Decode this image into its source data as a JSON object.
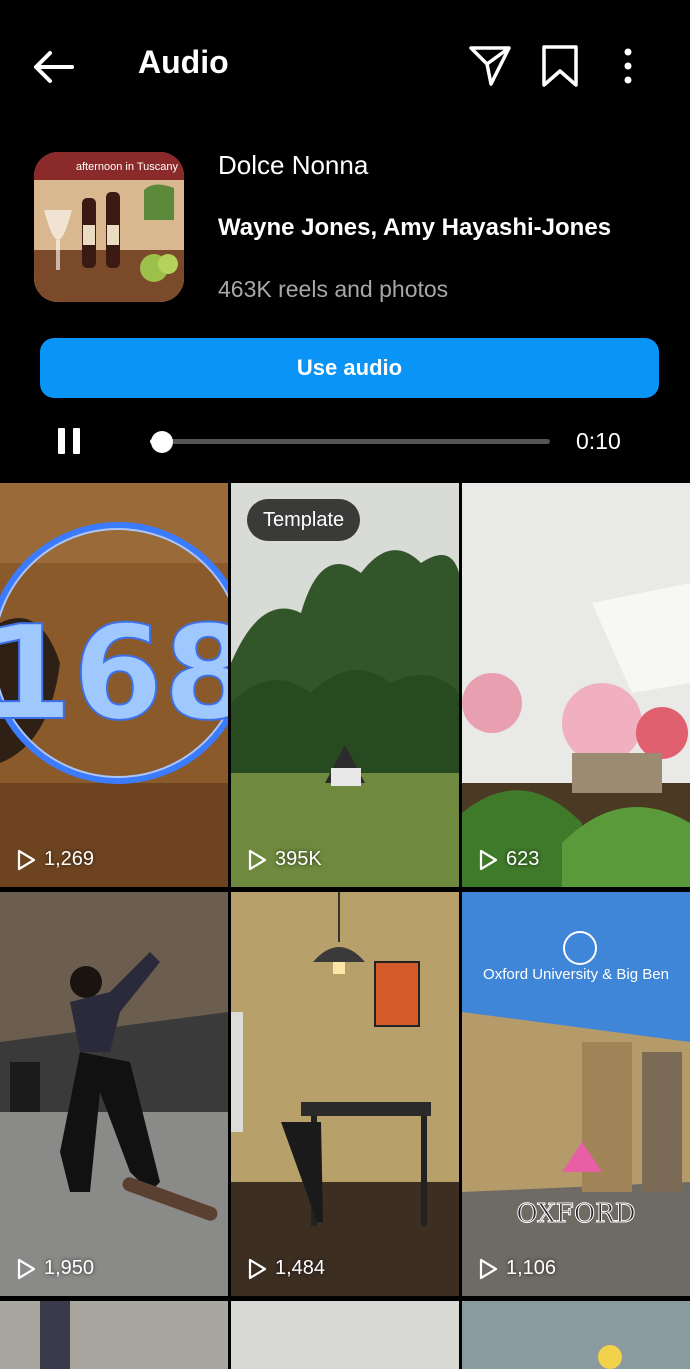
{
  "header": {
    "title": "Audio",
    "icons": [
      "back-arrow-icon",
      "send-icon",
      "bookmark-icon",
      "more-vertical-icon"
    ]
  },
  "audio": {
    "art_caption": "afternoon in Tuscany",
    "song_title": "Dolce Nonna",
    "artists": "Wayne Jones, Amy Hayashi-Jones",
    "usage_count": "463K reels and photos",
    "use_button": "Use audio",
    "playback": {
      "elapsed": "0:10",
      "state": "playing",
      "progress": 0.03
    },
    "accent_color": "#0a95f6"
  },
  "reels": [
    {
      "views": "1,269",
      "badge": "",
      "overlay": ""
    },
    {
      "views": "395K",
      "badge": "Template",
      "overlay": ""
    },
    {
      "views": "623",
      "badge": "",
      "overlay": ""
    },
    {
      "views": "1,950",
      "badge": "",
      "overlay": ""
    },
    {
      "views": "1,484",
      "badge": "",
      "overlay": ""
    },
    {
      "views": "1,106",
      "badge": "",
      "overlay": "Oxford University & Big Ben"
    }
  ]
}
